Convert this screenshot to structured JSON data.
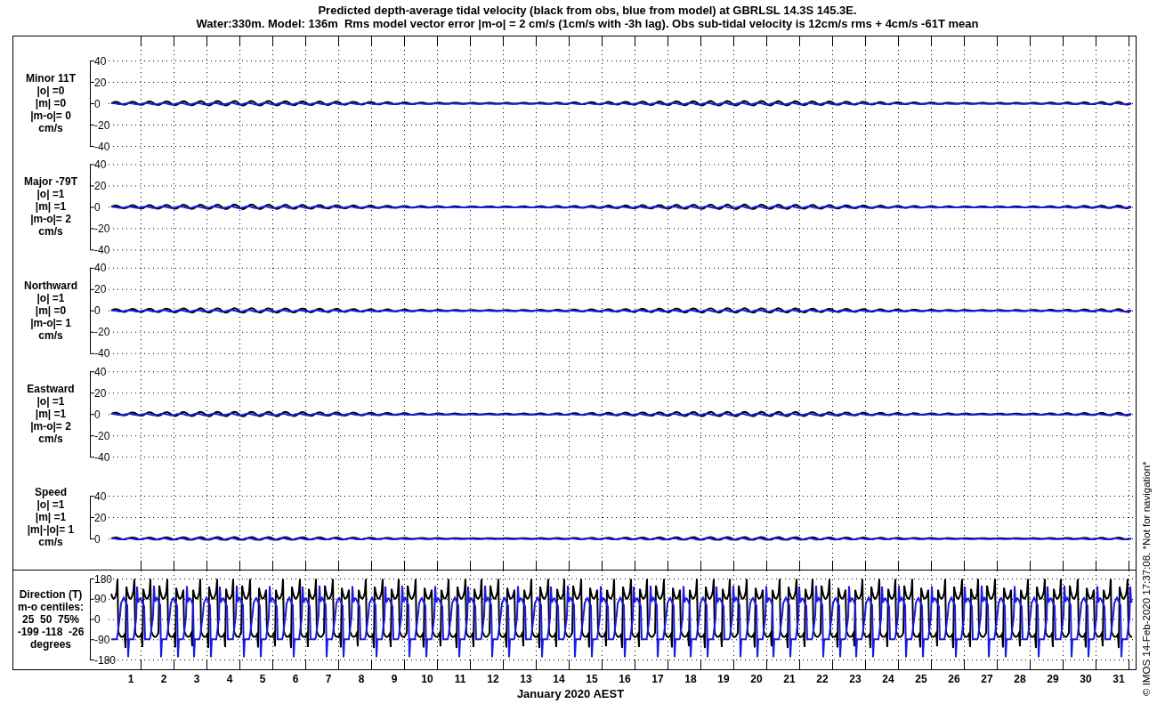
{
  "title_lines": [
    "Predicted depth-average tidal velocity (black from obs, blue from model) at GBRLSL 14.3S 145.3E.",
    "Water:330m. Model: 136m  Rms model vector error |m-o| = 2 cm/s (1cm/s with -3h lag). Obs sub-tidal velocity is 12cm/s rms + 4cm/s -61T mean"
  ],
  "panels": [
    {
      "kind": "velocity",
      "label_lines": [
        "Minor 11T",
        "|o| =0",
        "|m| =0",
        "|m-o|= 0",
        "cm/s"
      ],
      "yticks": [
        "40",
        "20",
        "0",
        "-20",
        "-40"
      ]
    },
    {
      "kind": "velocity",
      "label_lines": [
        "Major -79T",
        "|o| =1",
        "|m| =1",
        "|m-o|= 2",
        "cm/s"
      ],
      "yticks": [
        "40",
        "20",
        "0",
        "-20",
        "-40"
      ]
    },
    {
      "kind": "velocity",
      "label_lines": [
        "Northward",
        "|o| =1",
        "|m| =0",
        "|m-o|= 1",
        "cm/s"
      ],
      "yticks": [
        "40",
        "20",
        "0",
        "-20",
        "-40"
      ]
    },
    {
      "kind": "velocity",
      "label_lines": [
        "Eastward",
        "|o| =1",
        "|m| =1",
        "|m-o|= 2",
        "cm/s"
      ],
      "yticks": [
        "40",
        "20",
        "0",
        "-20",
        "-40"
      ]
    },
    {
      "kind": "speed",
      "label_lines": [
        "Speed",
        "|o| =1",
        "|m| =1",
        "|m|-|o|= 1",
        "cm/s"
      ],
      "yticks": [
        "40",
        "20",
        "0"
      ]
    },
    {
      "kind": "direction",
      "label_lines": [
        "Direction (T)",
        "m-o centiles:",
        "25  50  75%",
        "-199 -118  -26",
        "degrees"
      ],
      "yticks": [
        "180",
        "90",
        "0",
        "-90",
        "-180"
      ]
    }
  ],
  "x_axis": {
    "day_labels": [
      "1",
      "2",
      "3",
      "4",
      "5",
      "6",
      "7",
      "8",
      "9",
      "10",
      "11",
      "12",
      "13",
      "14",
      "15",
      "16",
      "17",
      "18",
      "19",
      "20",
      "21",
      "22",
      "23",
      "24",
      "25",
      "26",
      "27",
      "28",
      "29",
      "30",
      "31"
    ],
    "title": "January 2020 AEST"
  },
  "footer_note": "© IMOS 14-Feb-2020 17:37:08. *Not for navigation*"
}
